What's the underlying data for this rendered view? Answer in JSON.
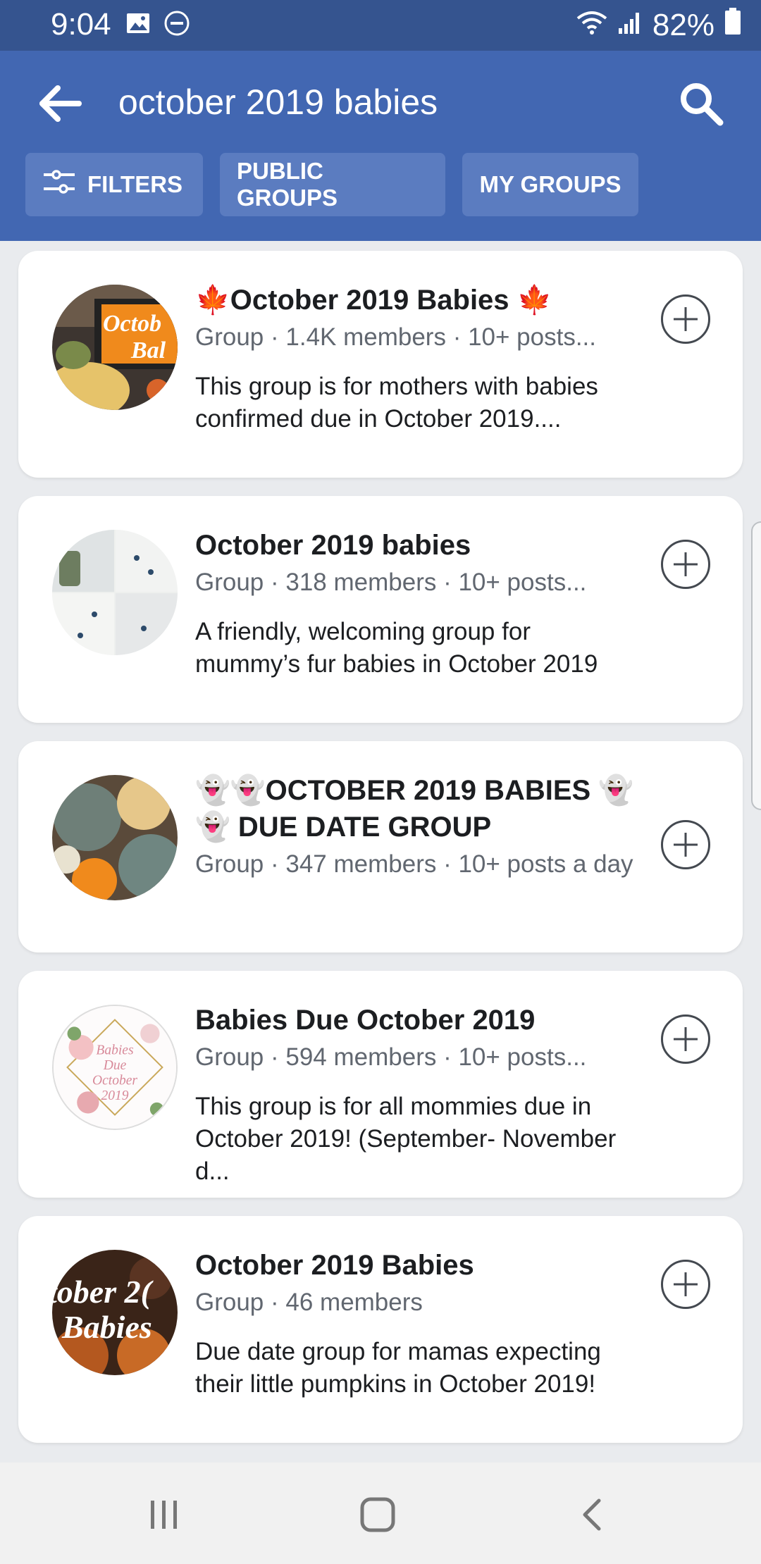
{
  "status_bar": {
    "time": "9:04",
    "battery": "82%",
    "icons": [
      "image-icon",
      "do-not-disturb-icon",
      "wifi-icon",
      "signal-icon",
      "battery-icon"
    ]
  },
  "app_bar": {
    "query": "october 2019 babies",
    "filters": [
      {
        "label": "FILTERS",
        "icon": "sliders-icon"
      },
      {
        "label": "PUBLIC GROUPS"
      },
      {
        "label": "MY GROUPS"
      }
    ]
  },
  "results": [
    {
      "title": "🍁October 2019 Babies 🍁",
      "meta": "Group · 1.4K members · 10+ posts...",
      "description": "This group is for mothers with babies confirmed due in October 2019....",
      "avatar_text": "Octob Bal"
    },
    {
      "title": "October 2019 babies",
      "meta": "Group · 318 members · 10+ posts...",
      "description": "A friendly, welcoming group for mummy’s fur babies in October 2019"
    },
    {
      "title": "👻👻OCTOBER 2019 BABIES 👻👻 DUE DATE GROUP",
      "meta": "Group · 347 members · 10+ posts a day",
      "description": ""
    },
    {
      "title": "Babies Due October 2019",
      "meta": "Group · 594 members · 10+ posts...",
      "description": "This group is for all mommies due in October 2019! (September- November d...",
      "avatar_text": "Babies Due October 2019"
    },
    {
      "title": "October 2019 Babies",
      "meta": "Group · 46 members",
      "description": "Due date group for mamas expecting their little pumpkins in October 2019!",
      "avatar_text": "tober 2( Babies"
    }
  ],
  "nav_bar": {
    "buttons": [
      "recents-icon",
      "home-icon",
      "back-icon"
    ]
  },
  "colors": {
    "header": "#4267b2",
    "status_bar": "#35548f",
    "chip": "#5b7cc0",
    "background": "#e9ebee"
  }
}
